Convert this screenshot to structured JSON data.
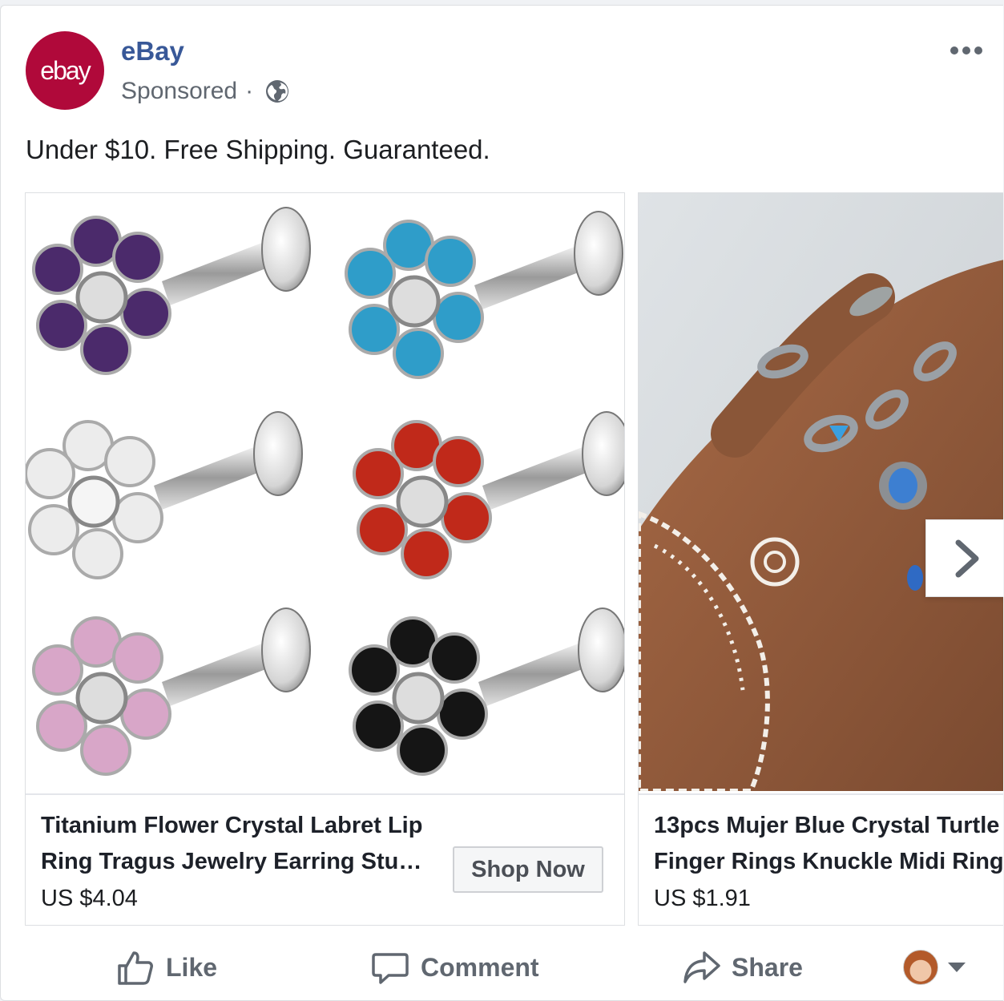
{
  "page": {
    "name": "eBay",
    "avatar_text": "ebay",
    "sponsored_label": "Sponsored",
    "separator": "·",
    "globe_icon": "globe-icon",
    "more_icon": "more-dots-icon"
  },
  "post": {
    "caption": "Under $10. Free Shipping. Guaranteed."
  },
  "carousel": {
    "cards": [
      {
        "title": "Titanium Flower Crystal Labret Lip\nRing Tragus Jewelry Earring Stu…",
        "price": "US $4.04",
        "cta_label": "Shop Now",
        "image_icon": "labret-studs-image"
      },
      {
        "title": "13pcs Mujer Blue Crystal Turtle\nFinger Rings Knuckle Midi Ring",
        "price": "US $1.91",
        "image_icon": "hand-rings-image"
      }
    ],
    "next_icon": "chevron-right-icon"
  },
  "actions": {
    "like_label": "Like",
    "comment_label": "Comment",
    "share_label": "Share"
  },
  "colors": {
    "brand_ebay": "#b0093a",
    "link_blue": "#385898",
    "text_muted": "#606770"
  }
}
